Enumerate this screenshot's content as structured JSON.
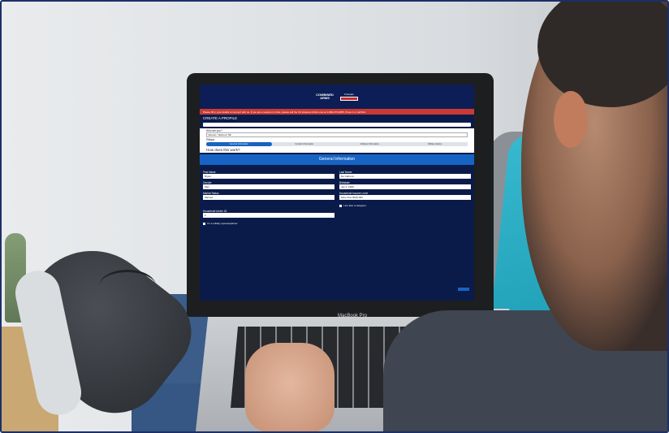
{
  "scene": {
    "device_label": "MacBook Pro"
  },
  "site": {
    "logo_line1": "COMBINED",
    "logo_line2": "ARMS",
    "language_label": "Français",
    "alert_text": "Please fill in your details to connect with us. If you are a veteran in crisis, please call the VA Veterans Crisis Line at 1-800-273-8255, Press 1 or call 911.",
    "section_title": "CREATE A PROFILE",
    "who_label": "Who are you?",
    "who_value": "Veteran / Retired / 6th",
    "steps_title": "Steps",
    "steps": [
      "General Information",
      "Contact Information",
      "Address Information",
      "Military History"
    ],
    "how_title": "How does this work?",
    "form_title": "General Information",
    "fields": [
      {
        "label": "First Name",
        "value": "Bryan"
      },
      {
        "label": "Last Name",
        "value": "De Cabrera"
      },
      {
        "label": "Gender",
        "value": "Man"
      },
      {
        "label": "Birthdate",
        "value": "Jan 3, 1980"
      },
      {
        "label": "Marital Status",
        "value": "Married"
      },
      {
        "label": "Household Income Level",
        "value": "More than $100,000"
      },
      {
        "label": "Household Under 18",
        "value": "2"
      }
    ],
    "caregiver_label": "I am also a caregiver",
    "spouse_label": "I'm a military spouse/partner"
  }
}
